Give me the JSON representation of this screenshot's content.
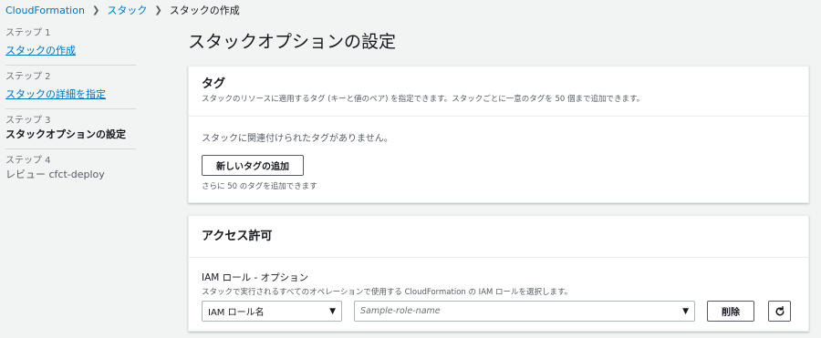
{
  "breadcrumb": {
    "items": [
      "CloudFormation",
      "スタック",
      "スタックの作成"
    ]
  },
  "steps": [
    {
      "num": "ステップ 1",
      "title": "スタックの作成"
    },
    {
      "num": "ステップ 2",
      "title": "スタックの詳細を指定"
    },
    {
      "num": "ステップ 3",
      "title": "スタックオプションの設定"
    },
    {
      "num": "ステップ 4",
      "title": "レビュー cfct-deploy"
    }
  ],
  "page": {
    "title": "スタックオプションの設定"
  },
  "tags": {
    "title": "タグ",
    "description": "スタックのリソースに適用するタグ (キーと値のペア) を指定できます。スタックごとに一意のタグを 50 個まで追加できます。",
    "empty_text": "スタックに関連付けられたタグがありません。",
    "add_button": "新しいタグの追加",
    "hint": "さらに 50 のタグを追加できます"
  },
  "access": {
    "title": "アクセス許可",
    "field_label": "IAM ロール - オプション",
    "field_desc": "スタックで実行されるすべてのオペレーションで使用する CloudFormation の IAM ロールを選択します。",
    "role_type_value": "IAM ロール名",
    "role_name_placeholder": "Sample-role-name",
    "delete_button": "削除"
  },
  "icons": {
    "caret": "caret-down-icon",
    "refresh": "refresh-icon",
    "separator": "chevron-right-icon"
  }
}
